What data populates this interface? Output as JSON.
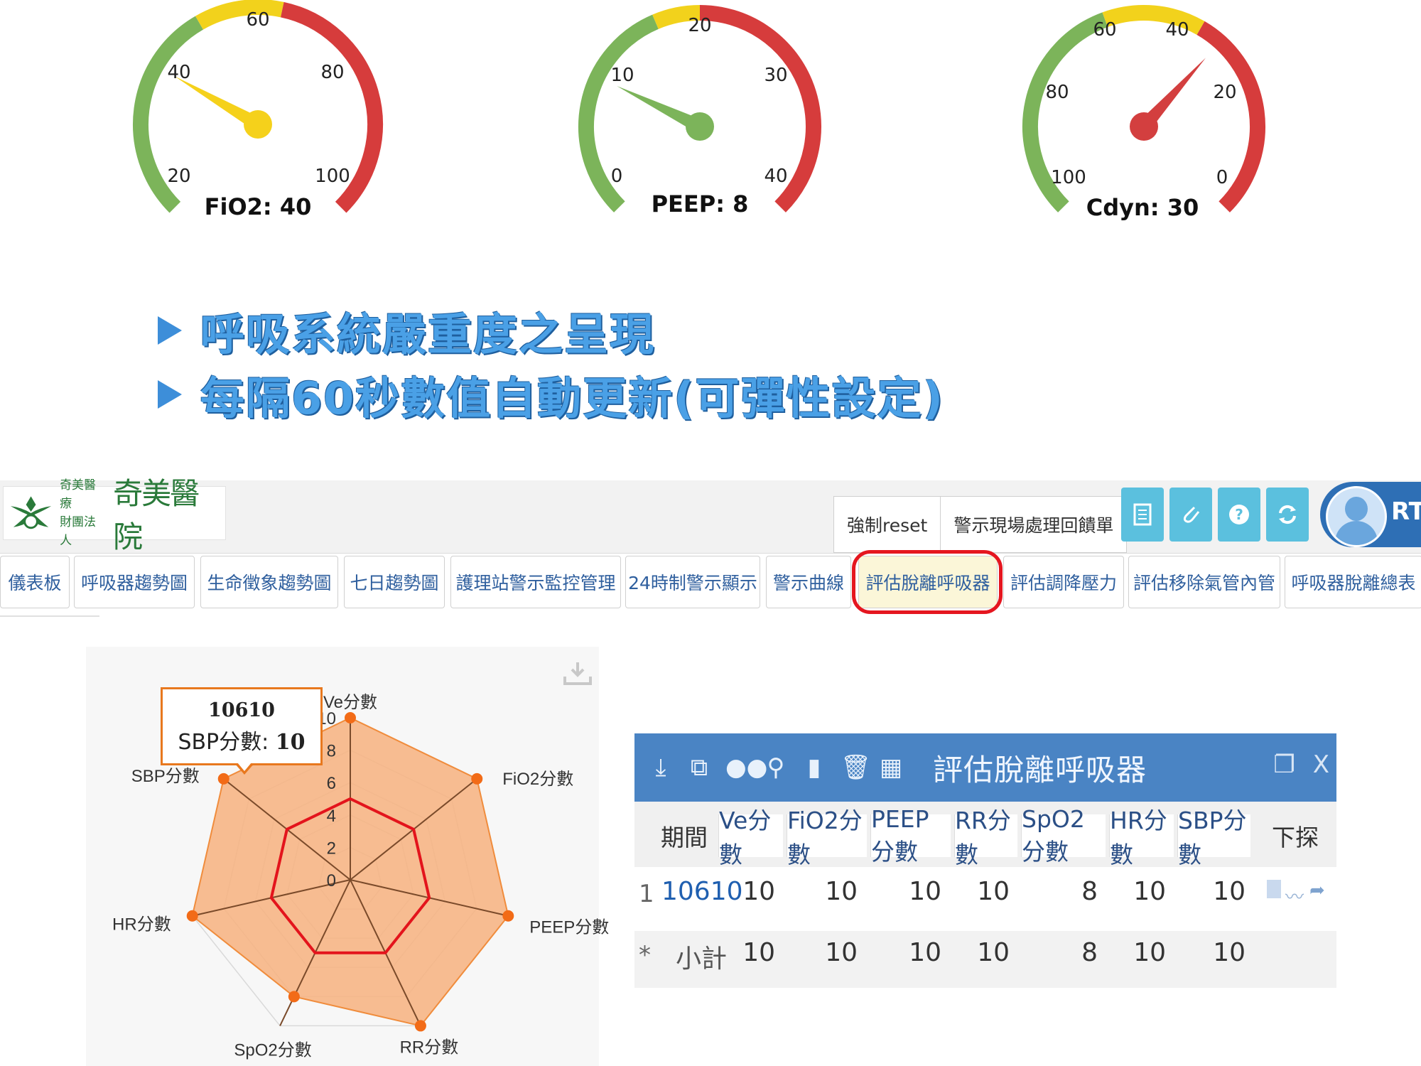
{
  "gauges": [
    {
      "id": "fio2",
      "label": "FiO2: 40",
      "ticks": [
        "20",
        "40",
        "60",
        "80",
        "100"
      ]
    },
    {
      "id": "peep",
      "label": "PEEP: 8",
      "ticks": [
        "0",
        "10",
        "20",
        "30",
        "40"
      ]
    },
    {
      "id": "cdyn",
      "label": "Cdyn: 30",
      "ticks": [
        "100",
        "80",
        "60",
        "40",
        "20",
        "0"
      ]
    }
  ],
  "bullets": [
    "呼吸系統嚴重度之呈現",
    "每隔60秒數值自動更新(可彈性設定)"
  ],
  "header": {
    "logo_small_line1": "奇美醫療",
    "logo_small_line2": "財團法人",
    "logo_big": "奇美醫院",
    "reset_button": "強制reset",
    "alert_form_button": "警示現場處理回饋單",
    "user_name": "RT"
  },
  "tabs": [
    "儀表板",
    "呼吸器趨勢圖",
    "生命徵象趨勢圖",
    "七日趨勢圖",
    "護理站警示監控管理",
    "24時制警示顯示",
    "警示曲線",
    "評估脫離呼吸器",
    "評估調降壓力",
    "評估移除氣管內管",
    "呼吸器脫離總表"
  ],
  "active_tab": "評估脫離呼吸器",
  "radar": {
    "axes": [
      "Ve分數",
      "FiO2分數",
      "PEEP分數",
      "RR分數",
      "SpO2分數",
      "HR分數",
      "SBP分數"
    ],
    "ticks": [
      "0",
      "2",
      "4",
      "6",
      "8",
      "10"
    ],
    "tooltip_title": "10610",
    "tooltip_label": "SBP分數: ",
    "tooltip_value": "10"
  },
  "chart_data": {
    "type": "radar",
    "categories": [
      "Ve分數",
      "FiO2分數",
      "PEEP分數",
      "RR分數",
      "SpO2分數",
      "HR分數",
      "SBP分數"
    ],
    "series": [
      {
        "name": "10610",
        "values": [
          10,
          10,
          10,
          10,
          8,
          10,
          10
        ]
      }
    ],
    "ylim": [
      0,
      10
    ]
  },
  "grid": {
    "title": "評估脫離呼吸器",
    "columns": [
      "期間",
      "Ve分數",
      "FiO2分數",
      "PEEP分數",
      "RR分數",
      "SpO2分數",
      "HR分數",
      "SBP分數",
      "下探"
    ],
    "rows": [
      {
        "num": "1",
        "cells": [
          "10610",
          "10",
          "10",
          "10",
          "10",
          "8",
          "10",
          "10"
        ]
      },
      {
        "num": "*",
        "cells": [
          "小計",
          "10",
          "10",
          "10",
          "10",
          "8",
          "10",
          "10"
        ]
      }
    ]
  }
}
